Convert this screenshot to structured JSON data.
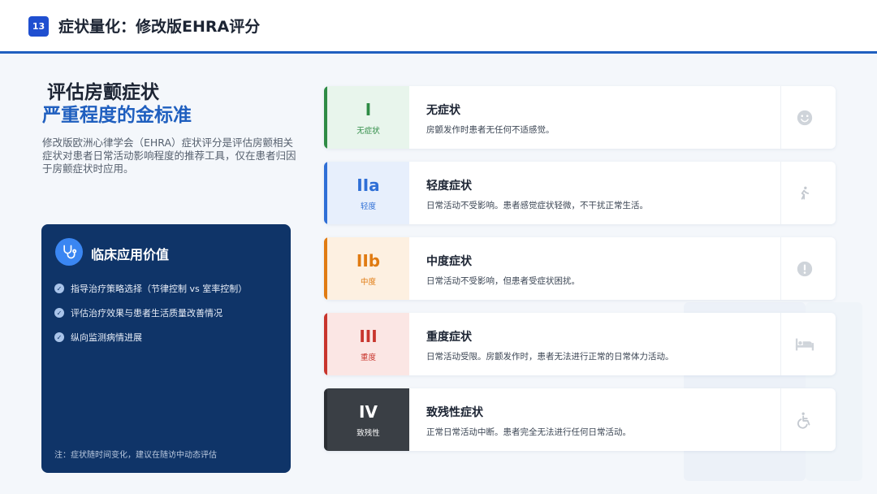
{
  "header": {
    "page_number": "13",
    "title": "症状量化：修改版EHRA评分"
  },
  "left": {
    "title_line1": "评估房颤症状",
    "title_line2": "严重程度的金标准",
    "description": "修改版欧洲心律学会（EHRA）症状评分是评估房颤相关症状对患者日常活动影响程度的推荐工具，仅在患者归因于房颤症状时应用。"
  },
  "clinical": {
    "icon": "stethoscope-icon",
    "title": "临床应用价值",
    "items": [
      "指导治疗策略选择（节律控制 vs 室率控制）",
      "评估治疗效果与患者生活质量改善情况",
      "纵向监测病情进展"
    ],
    "note": "注：症状随时间变化，建议在随访中动态评估"
  },
  "levels": [
    {
      "code": "I",
      "sub": "无症状",
      "name": "无症状",
      "desc": "房颤发作时患者无任何不适感觉。",
      "icon": "smile-icon",
      "color": "#2e8b45",
      "bg": "#e8f5ec"
    },
    {
      "code": "IIa",
      "sub": "轻度",
      "name": "轻度症状",
      "desc": "日常活动不受影响。患者感觉症状轻微，不干扰正常生活。",
      "icon": "walking-icon",
      "color": "#2f6fd6",
      "bg": "#e7effc"
    },
    {
      "code": "IIb",
      "sub": "中度",
      "name": "中度症状",
      "desc": "日常活动不受影响，但患者受症状困扰。",
      "icon": "alert-icon",
      "color": "#e07b12",
      "bg": "#fdf0e1"
    },
    {
      "code": "III",
      "sub": "重度",
      "name": "重度症状",
      "desc": "日常活动受限。房颤发作时，患者无法进行正常的日常体力活动。",
      "icon": "bed-icon",
      "color": "#c8352d",
      "bg": "#fbe6e4"
    },
    {
      "code": "IV",
      "sub": "致残性",
      "name": "致残性症状",
      "desc": "正常日常活动中断。患者完全无法进行任何日常活动。",
      "icon": "wheelchair-icon",
      "color": "#ffffff",
      "bg": "#3a3f45"
    }
  ]
}
